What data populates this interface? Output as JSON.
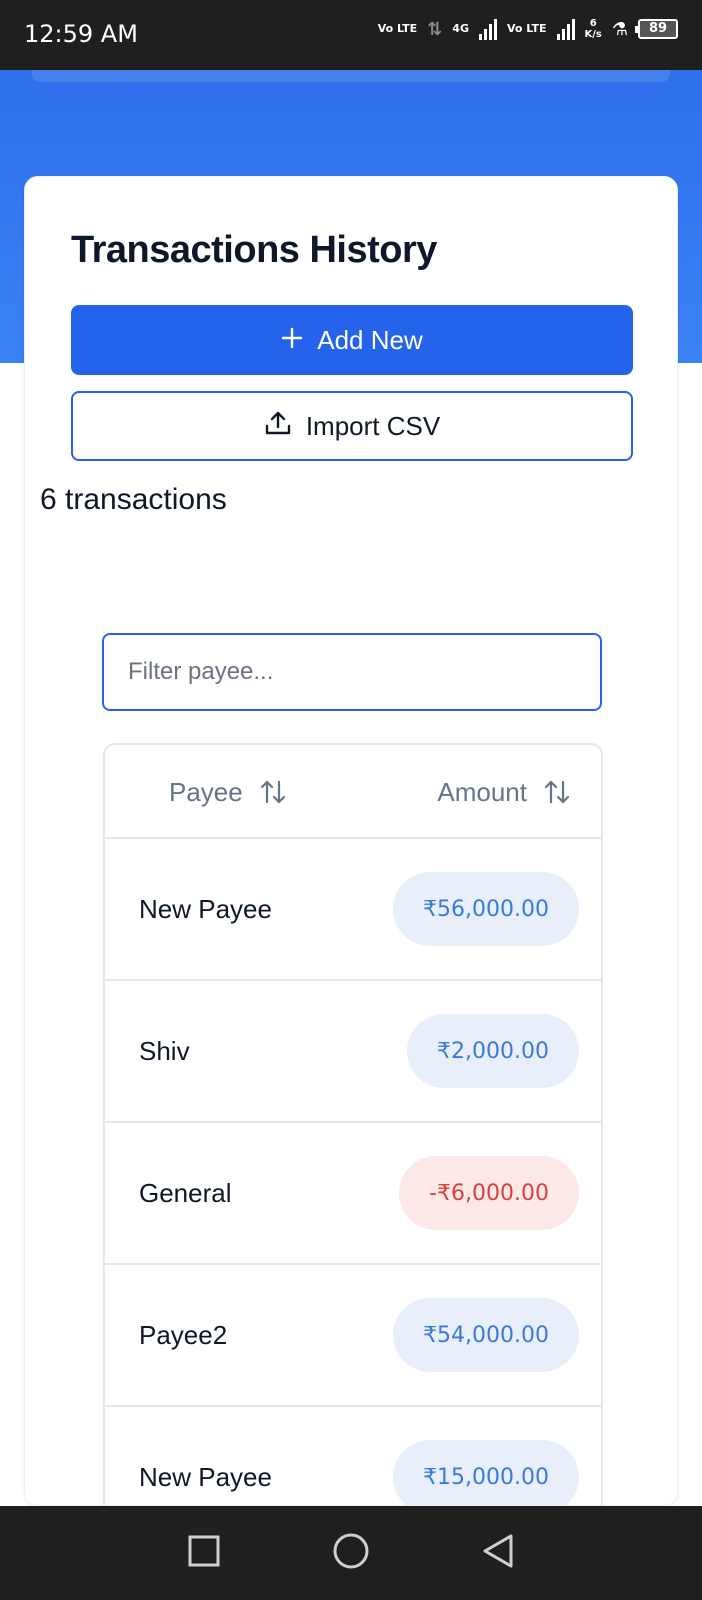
{
  "status_bar": {
    "time": "12:59 AM",
    "net1": "Vo LTE",
    "net2": "4G",
    "net3": "Vo LTE",
    "speed_value": "6",
    "speed_unit": "K/s",
    "battery": "89"
  },
  "card": {
    "title": "Transactions History",
    "add_label": "Add New",
    "import_label": "Import CSV",
    "count_text": "6 transactions"
  },
  "filter": {
    "placeholder": "Filter payee..."
  },
  "table": {
    "headers": {
      "payee": "Payee",
      "amount": "Amount"
    },
    "rows": [
      {
        "payee": "New Payee",
        "amount": "₹56,000.00",
        "negative": false
      },
      {
        "payee": "Shiv",
        "amount": "₹2,000.00",
        "negative": false
      },
      {
        "payee": "General",
        "amount": "-₹6,000.00",
        "negative": true
      },
      {
        "payee": "Payee2",
        "amount": "₹54,000.00",
        "negative": false
      },
      {
        "payee": "New Payee",
        "amount": "₹15,000.00",
        "negative": false
      }
    ]
  },
  "colors": {
    "primary": "#2563eb",
    "positive_text": "#3b7ad8",
    "positive_bg": "#e8effb",
    "negative_text": "#dc3f3f",
    "negative_bg": "#fde8e8"
  },
  "icons": {
    "add": "plus-icon",
    "import": "upload-icon",
    "sort": "sort-arrows-icon",
    "nav_recent": "square-icon",
    "nav_home": "circle-icon",
    "nav_back": "triangle-back-icon"
  }
}
